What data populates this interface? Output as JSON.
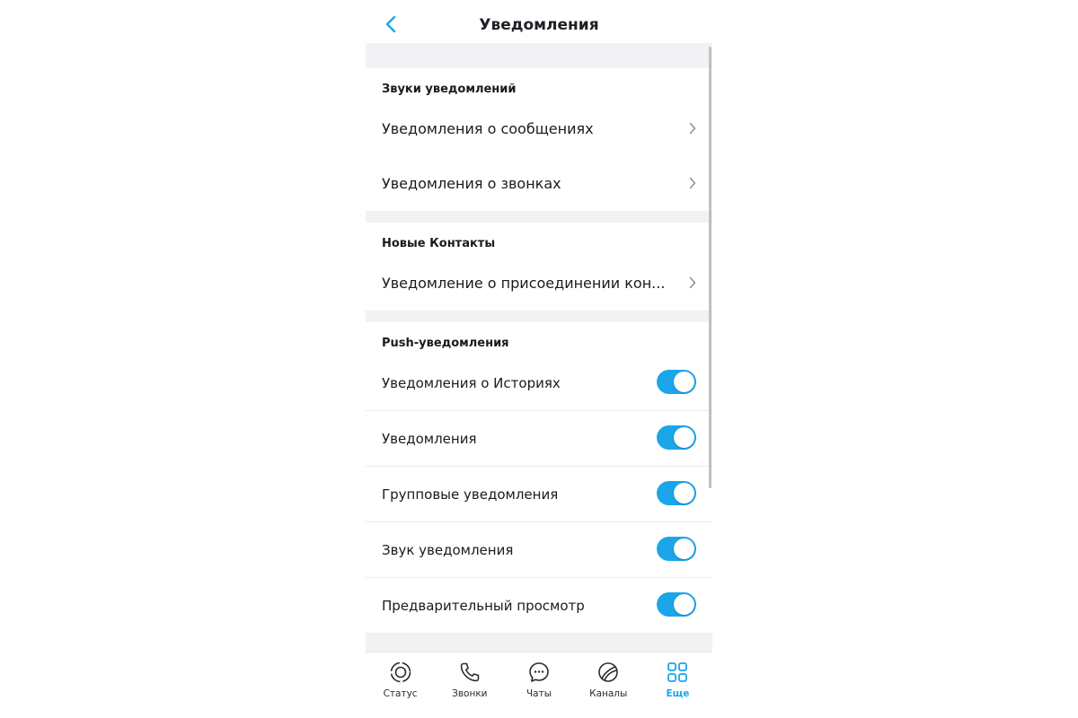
{
  "header": {
    "title": "Уведомления",
    "back_icon": "chevron-left-icon"
  },
  "sections": {
    "sounds": {
      "title": "Звуки уведомлений",
      "items": [
        {
          "label": "Уведомления о сообщениях"
        },
        {
          "label": "Уведомления о звонках"
        }
      ]
    },
    "contacts": {
      "title": "Новые Контакты",
      "items": [
        {
          "label": "Уведомление о присоединении кон..."
        }
      ]
    },
    "push": {
      "title": "Push-уведомления",
      "items": [
        {
          "label": "Уведомления о Историях",
          "enabled": true
        },
        {
          "label": "Уведомления",
          "enabled": true
        },
        {
          "label": "Групповые уведомления",
          "enabled": true
        },
        {
          "label": "Звук уведомления",
          "enabled": true
        },
        {
          "label": "Предварительный просмотр",
          "enabled": true
        }
      ]
    }
  },
  "tabbar": [
    {
      "label": "Статус",
      "icon": "status-icon",
      "active": false
    },
    {
      "label": "Звонки",
      "icon": "phone-icon",
      "active": false
    },
    {
      "label": "Чаты",
      "icon": "chat-icon",
      "active": false
    },
    {
      "label": "Каналы",
      "icon": "channels-icon",
      "active": false
    },
    {
      "label": "Еще",
      "icon": "grid-icon",
      "active": true
    }
  ],
  "colors": {
    "accent": "#1aa6e8",
    "separator": "#f2f2f4",
    "text": "#1b1b1f"
  }
}
